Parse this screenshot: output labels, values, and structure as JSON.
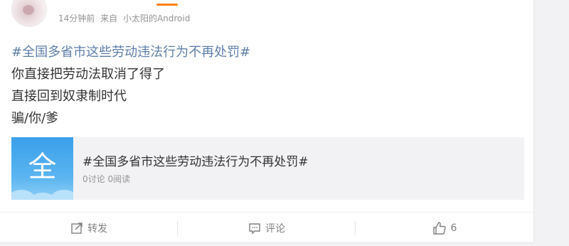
{
  "post": {
    "meta": {
      "time": "14分钟前",
      "source_prefix": "来自",
      "source": "小太阳的Android"
    },
    "hashtag": "#全国多省市这些劳动违法行为不再处罚#",
    "lines": [
      "你直接把劳动法取消了得了",
      "直接回到奴隶制时代",
      "骗/你/爹"
    ]
  },
  "topic_card": {
    "thumb_glyph": "全",
    "title": "#全国多省市这些劳动违法行为不再处罚#",
    "stats": "0讨论 0阅读"
  },
  "actions": {
    "repost_label": "转发",
    "comment_label": "评论",
    "like_count": "6"
  },
  "colors": {
    "hashtag": "#5d7ea9",
    "accent": "#ff8200",
    "muted": "#939393"
  },
  "icons": {
    "repost": "repost-icon",
    "comment": "comment-icon",
    "like": "thumbs-up-icon"
  }
}
